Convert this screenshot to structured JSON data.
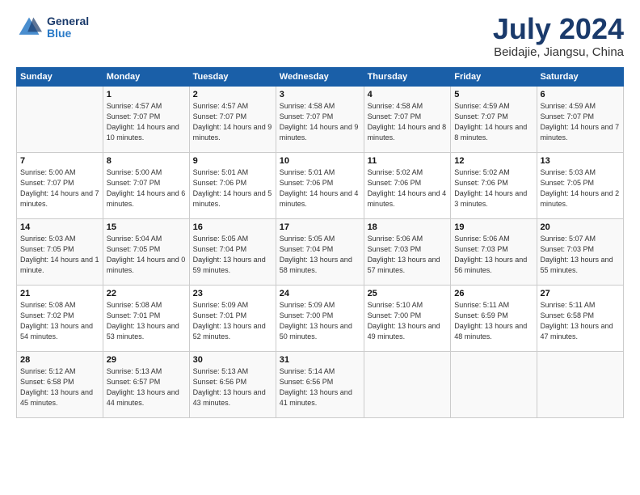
{
  "header": {
    "logo": {
      "general": "General",
      "blue": "Blue"
    },
    "title": "July 2024",
    "location": "Beidajie, Jiangsu, China"
  },
  "weekdays": [
    "Sunday",
    "Monday",
    "Tuesday",
    "Wednesday",
    "Thursday",
    "Friday",
    "Saturday"
  ],
  "weeks": [
    [
      {
        "day": "",
        "sunrise": "",
        "sunset": "",
        "daylight": ""
      },
      {
        "day": "1",
        "sunrise": "Sunrise: 4:57 AM",
        "sunset": "Sunset: 7:07 PM",
        "daylight": "Daylight: 14 hours and 10 minutes."
      },
      {
        "day": "2",
        "sunrise": "Sunrise: 4:57 AM",
        "sunset": "Sunset: 7:07 PM",
        "daylight": "Daylight: 14 hours and 9 minutes."
      },
      {
        "day": "3",
        "sunrise": "Sunrise: 4:58 AM",
        "sunset": "Sunset: 7:07 PM",
        "daylight": "Daylight: 14 hours and 9 minutes."
      },
      {
        "day": "4",
        "sunrise": "Sunrise: 4:58 AM",
        "sunset": "Sunset: 7:07 PM",
        "daylight": "Daylight: 14 hours and 8 minutes."
      },
      {
        "day": "5",
        "sunrise": "Sunrise: 4:59 AM",
        "sunset": "Sunset: 7:07 PM",
        "daylight": "Daylight: 14 hours and 8 minutes."
      },
      {
        "day": "6",
        "sunrise": "Sunrise: 4:59 AM",
        "sunset": "Sunset: 7:07 PM",
        "daylight": "Daylight: 14 hours and 7 minutes."
      }
    ],
    [
      {
        "day": "7",
        "sunrise": "Sunrise: 5:00 AM",
        "sunset": "Sunset: 7:07 PM",
        "daylight": "Daylight: 14 hours and 7 minutes."
      },
      {
        "day": "8",
        "sunrise": "Sunrise: 5:00 AM",
        "sunset": "Sunset: 7:07 PM",
        "daylight": "Daylight: 14 hours and 6 minutes."
      },
      {
        "day": "9",
        "sunrise": "Sunrise: 5:01 AM",
        "sunset": "Sunset: 7:06 PM",
        "daylight": "Daylight: 14 hours and 5 minutes."
      },
      {
        "day": "10",
        "sunrise": "Sunrise: 5:01 AM",
        "sunset": "Sunset: 7:06 PM",
        "daylight": "Daylight: 14 hours and 4 minutes."
      },
      {
        "day": "11",
        "sunrise": "Sunrise: 5:02 AM",
        "sunset": "Sunset: 7:06 PM",
        "daylight": "Daylight: 14 hours and 4 minutes."
      },
      {
        "day": "12",
        "sunrise": "Sunrise: 5:02 AM",
        "sunset": "Sunset: 7:06 PM",
        "daylight": "Daylight: 14 hours and 3 minutes."
      },
      {
        "day": "13",
        "sunrise": "Sunrise: 5:03 AM",
        "sunset": "Sunset: 7:05 PM",
        "daylight": "Daylight: 14 hours and 2 minutes."
      }
    ],
    [
      {
        "day": "14",
        "sunrise": "Sunrise: 5:03 AM",
        "sunset": "Sunset: 7:05 PM",
        "daylight": "Daylight: 14 hours and 1 minute."
      },
      {
        "day": "15",
        "sunrise": "Sunrise: 5:04 AM",
        "sunset": "Sunset: 7:05 PM",
        "daylight": "Daylight: 14 hours and 0 minutes."
      },
      {
        "day": "16",
        "sunrise": "Sunrise: 5:05 AM",
        "sunset": "Sunset: 7:04 PM",
        "daylight": "Daylight: 13 hours and 59 minutes."
      },
      {
        "day": "17",
        "sunrise": "Sunrise: 5:05 AM",
        "sunset": "Sunset: 7:04 PM",
        "daylight": "Daylight: 13 hours and 58 minutes."
      },
      {
        "day": "18",
        "sunrise": "Sunrise: 5:06 AM",
        "sunset": "Sunset: 7:03 PM",
        "daylight": "Daylight: 13 hours and 57 minutes."
      },
      {
        "day": "19",
        "sunrise": "Sunrise: 5:06 AM",
        "sunset": "Sunset: 7:03 PM",
        "daylight": "Daylight: 13 hours and 56 minutes."
      },
      {
        "day": "20",
        "sunrise": "Sunrise: 5:07 AM",
        "sunset": "Sunset: 7:03 PM",
        "daylight": "Daylight: 13 hours and 55 minutes."
      }
    ],
    [
      {
        "day": "21",
        "sunrise": "Sunrise: 5:08 AM",
        "sunset": "Sunset: 7:02 PM",
        "daylight": "Daylight: 13 hours and 54 minutes."
      },
      {
        "day": "22",
        "sunrise": "Sunrise: 5:08 AM",
        "sunset": "Sunset: 7:01 PM",
        "daylight": "Daylight: 13 hours and 53 minutes."
      },
      {
        "day": "23",
        "sunrise": "Sunrise: 5:09 AM",
        "sunset": "Sunset: 7:01 PM",
        "daylight": "Daylight: 13 hours and 52 minutes."
      },
      {
        "day": "24",
        "sunrise": "Sunrise: 5:09 AM",
        "sunset": "Sunset: 7:00 PM",
        "daylight": "Daylight: 13 hours and 50 minutes."
      },
      {
        "day": "25",
        "sunrise": "Sunrise: 5:10 AM",
        "sunset": "Sunset: 7:00 PM",
        "daylight": "Daylight: 13 hours and 49 minutes."
      },
      {
        "day": "26",
        "sunrise": "Sunrise: 5:11 AM",
        "sunset": "Sunset: 6:59 PM",
        "daylight": "Daylight: 13 hours and 48 minutes."
      },
      {
        "day": "27",
        "sunrise": "Sunrise: 5:11 AM",
        "sunset": "Sunset: 6:58 PM",
        "daylight": "Daylight: 13 hours and 47 minutes."
      }
    ],
    [
      {
        "day": "28",
        "sunrise": "Sunrise: 5:12 AM",
        "sunset": "Sunset: 6:58 PM",
        "daylight": "Daylight: 13 hours and 45 minutes."
      },
      {
        "day": "29",
        "sunrise": "Sunrise: 5:13 AM",
        "sunset": "Sunset: 6:57 PM",
        "daylight": "Daylight: 13 hours and 44 minutes."
      },
      {
        "day": "30",
        "sunrise": "Sunrise: 5:13 AM",
        "sunset": "Sunset: 6:56 PM",
        "daylight": "Daylight: 13 hours and 43 minutes."
      },
      {
        "day": "31",
        "sunrise": "Sunrise: 5:14 AM",
        "sunset": "Sunset: 6:56 PM",
        "daylight": "Daylight: 13 hours and 41 minutes."
      },
      {
        "day": "",
        "sunrise": "",
        "sunset": "",
        "daylight": ""
      },
      {
        "day": "",
        "sunrise": "",
        "sunset": "",
        "daylight": ""
      },
      {
        "day": "",
        "sunrise": "",
        "sunset": "",
        "daylight": ""
      }
    ]
  ]
}
